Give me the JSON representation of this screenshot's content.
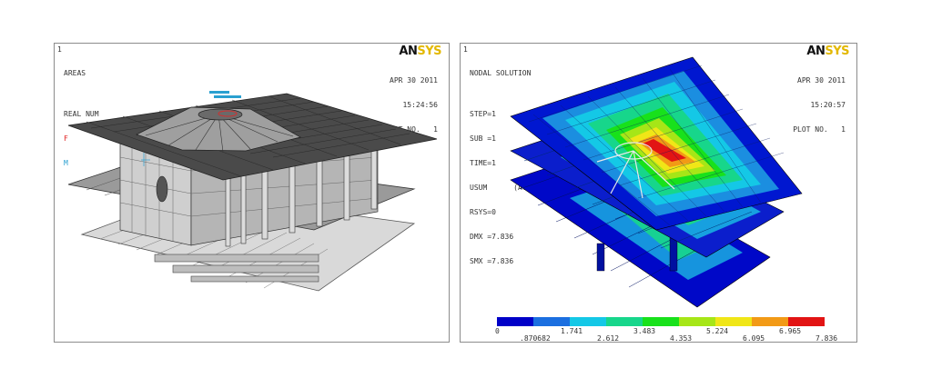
{
  "left": {
    "window_number": "1",
    "info_lines": [
      "AREAS",
      "",
      "REAL NUM"
    ],
    "legend_f": "F",
    "legend_m": "M",
    "date": "APR 30 2011",
    "time": "15:24:56",
    "plot": "PLOT NO.   1",
    "logo_a": "AN",
    "logo_b": "SYS"
  },
  "right": {
    "window_number": "1",
    "info_lines": [
      "NODAL SOLUTION",
      "",
      "STEP=1",
      "SUB =1",
      "TIME=1",
      "USUM      (AVG)",
      "RSYS=0",
      "DMX =7.836",
      "SMX =7.836"
    ],
    "date": "APR 30 2011",
    "time": "15:20:57",
    "plot": "PLOT NO.   1",
    "logo_a": "AN",
    "logo_b": "SYS",
    "colorbar": {
      "colors": [
        "#0000c8",
        "#1b6fe0",
        "#14c8e6",
        "#17d68b",
        "#18e11b",
        "#a6e617",
        "#f0e617",
        "#f29a16",
        "#e21414"
      ],
      "top_labels": [
        "0",
        "1.741",
        "3.483",
        "5.224",
        "6.965"
      ],
      "bottom_labels": [
        ".870682",
        "2.612",
        "4.353",
        "6.095",
        "7.836"
      ]
    }
  },
  "colors": {
    "panel_border": "#8c8c8c",
    "mesh_gray": "#7a7a7a",
    "mesh_dark": "#3a3a3a"
  }
}
